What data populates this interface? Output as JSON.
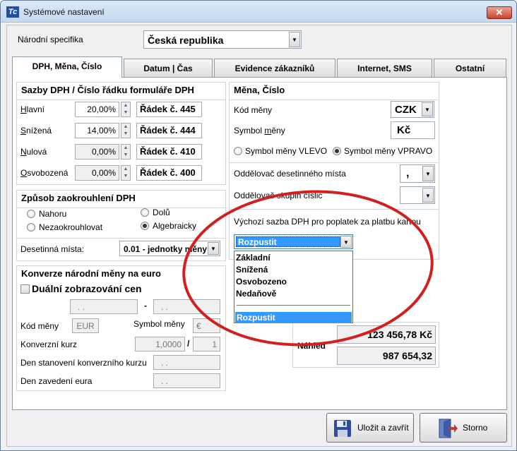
{
  "window": {
    "title": "Systémové nastavení",
    "close_glyph": "✕",
    "icon_text": "Tc"
  },
  "national": {
    "label": "Národní specifika",
    "value": "Česká republika"
  },
  "tabs": [
    {
      "label": "DPH, Měna, Číslo"
    },
    {
      "label": "Datum | Čas"
    },
    {
      "label": "Evidence zákazníků"
    },
    {
      "label": "Internet, SMS"
    },
    {
      "label": "Ostatní"
    }
  ],
  "vat": {
    "title": "Sazby DPH / Číslo řádku formuláře DPH",
    "rows": [
      {
        "label_u": "H",
        "label_rest": "lavní",
        "rate": "20,00%",
        "row": "Řádek č. 445"
      },
      {
        "label_u": "S",
        "label_rest": "nížená",
        "rate": "14,00%",
        "row": "Řádek č. 444"
      },
      {
        "label_u": "N",
        "label_rest": "ulová",
        "rate": "0,00%",
        "row": "Řádek č. 410"
      },
      {
        "label_u": "O",
        "label_rest": "svobozená",
        "rate": "0,00%",
        "row": "Řádek č. 400"
      }
    ]
  },
  "rounding": {
    "title": "Způsob zaokrouhlení DPH",
    "opt_up": "Nahoru",
    "opt_down": "Dolů",
    "opt_none": "Nezaokrouhlovat",
    "opt_alg": "Algebraicky",
    "decimals_label": "Desetinná místa:",
    "decimals_value": "0.01 - jednotky měny"
  },
  "euro": {
    "title": "Konverze národní měny na euro",
    "dual_label": "Duální zobrazování cen",
    "date_placeholder": ". .",
    "currency_label": "Kód měny",
    "currency_value": "EUR",
    "symbol_label": "Symbol měny",
    "symbol_value": "€",
    "rate_label": "Konverzní kurz",
    "rate_value": "1,0000",
    "rate_div": "/",
    "rate_unit": "1",
    "rate_date_label": "Den stanovení konverzního kurzu",
    "euro_date_label": "Den zavedení eura"
  },
  "currency": {
    "title": "Měna, Číslo",
    "code_label": "Kód měny",
    "code_value": "CZK",
    "symbol_label_pre": "Symbol ",
    "symbol_label_u": "m",
    "symbol_label_post": "ěny",
    "symbol_value": "Kč",
    "left_label": "Symbol měny VLEVO",
    "right_label": "Symbol měny VPRAVO",
    "decimal_sep_label": "Oddělovač desetinného místa",
    "decimal_sep_value": ",",
    "group_sep_label": "Oddělovač skupin číslic",
    "group_sep_value": ""
  },
  "card_fee": {
    "label": "Výchozí sazba DPH pro poplatek za platbu kartou",
    "selected": "Rozpustit",
    "options": [
      "Základní",
      "Snížená",
      "Osvobozeno",
      "Nedaňově",
      "Rozpustit"
    ]
  },
  "preview": {
    "label": "Náhled",
    "value1": "123 456,78 Kč",
    "value2": "987 654,32"
  },
  "buttons": {
    "save": "Uložit a zavřít",
    "cancel": "Storno"
  },
  "colors": {
    "highlight": "#3399ff",
    "annotation": "#d21f1f"
  }
}
